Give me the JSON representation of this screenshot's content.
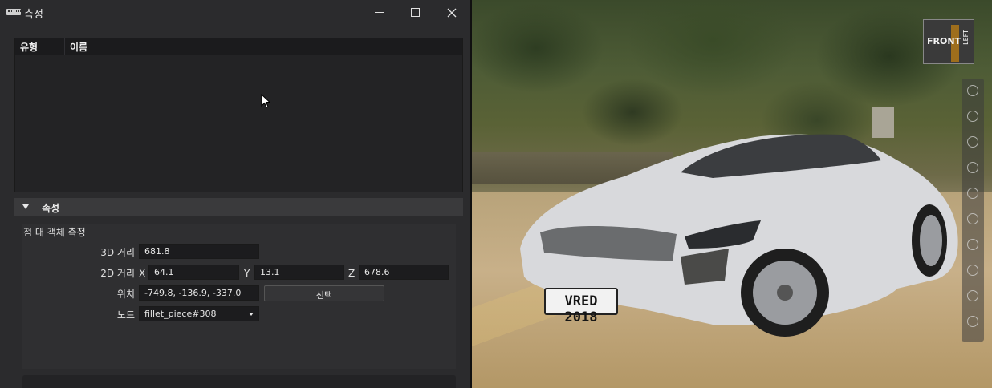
{
  "window": {
    "title": "측정"
  },
  "list": {
    "columns": [
      "유형",
      "이름"
    ]
  },
  "properties": {
    "header": "속성",
    "section_title": "점 대 객체 측정",
    "distance3d_label": "3D 거리",
    "distance3d_value": "681.8",
    "distance2d_label": "2D 거리",
    "x_label": "X",
    "x_value": "64.1",
    "y_label": "Y",
    "y_value": "13.1",
    "z_label": "Z",
    "z_value": "678.6",
    "position_label": "위치",
    "position_value": "-749.8, -136.9, -337.0",
    "select_button": "선택",
    "node_label": "노드",
    "node_value": "fillet_piece#308"
  },
  "viewport": {
    "license_plate": "VRED 2018",
    "viewcube_front": "FRONT",
    "viewcube_left": "LEFT"
  },
  "colors": {
    "panel_bg": "#2b2b2d",
    "field_bg": "#1c1c1e",
    "header_bg": "#3a3a3c",
    "viewcube_accent": "#b07818"
  }
}
